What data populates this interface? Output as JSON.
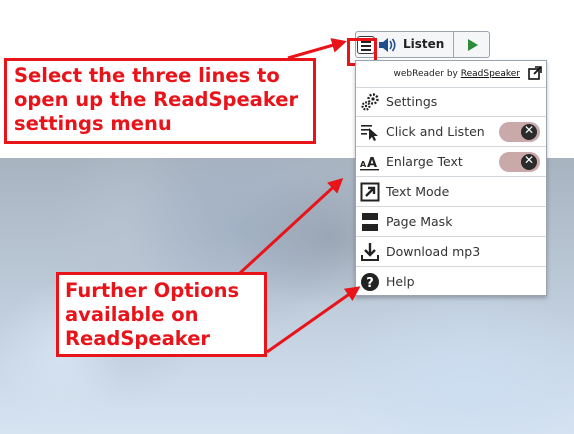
{
  "listen_bar": {
    "listen_label": "Listen",
    "icons": [
      "menu-icon",
      "speaker-icon",
      "play-icon"
    ]
  },
  "panel": {
    "brand_prefix": "webReader by",
    "brand_link": "ReadSpeaker",
    "items": [
      {
        "label": "Settings",
        "icon": "settings-gears-icon"
      },
      {
        "label": "Click and Listen",
        "icon": "click-listen-icon",
        "toggle": "off"
      },
      {
        "label": "Enlarge Text",
        "icon": "enlarge-text-icon",
        "toggle": "off"
      },
      {
        "label": "Text Mode",
        "icon": "text-mode-icon"
      },
      {
        "label": "Page Mask",
        "icon": "page-mask-icon"
      },
      {
        "label": "Download mp3",
        "icon": "download-icon"
      },
      {
        "label": "Help",
        "icon": "help-icon"
      }
    ]
  },
  "annotations": {
    "callout1": [
      "Select the three lines to",
      "open up the ReadSpeaker",
      "settings menu"
    ],
    "callout2": [
      "Further Options",
      "available on",
      "ReadSpeaker"
    ]
  },
  "colors": {
    "annotation_red": "#e8141a",
    "play_green": "#2e8b3a",
    "toggle_off": "#c9a9aa"
  }
}
